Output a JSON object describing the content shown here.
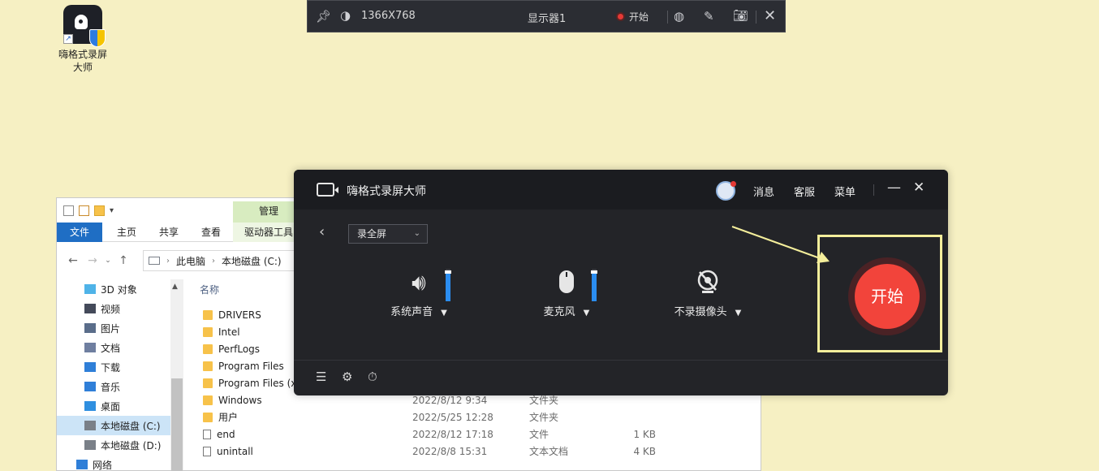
{
  "desktop": {
    "icon_label_line1": "嗨格式录屏",
    "icon_label_line2": "大师"
  },
  "topbar": {
    "resolution": "1366X768",
    "display": "显示器1",
    "record_label": "开始"
  },
  "explorer": {
    "ribbon_tabs": [
      "文件",
      "主页",
      "共享",
      "查看"
    ],
    "manage_tab": "管理",
    "drive_tools_tab": "驱动器工具",
    "breadcrumb": [
      "此电脑",
      "本地磁盘 (C:)"
    ],
    "tree_items": [
      {
        "label": "3D 对象",
        "icon": "3d-objects-icon",
        "color": "#4fb3e8"
      },
      {
        "label": "视频",
        "icon": "video-icon",
        "color": "#444a5a"
      },
      {
        "label": "图片",
        "icon": "pictures-icon",
        "color": "#5a6d8a"
      },
      {
        "label": "文档",
        "icon": "documents-icon",
        "color": "#6f7fa0"
      },
      {
        "label": "下载",
        "icon": "download-icon",
        "color": "#2f7fd8"
      },
      {
        "label": "音乐",
        "icon": "music-icon",
        "color": "#2f7fd8"
      },
      {
        "label": "桌面",
        "icon": "desktop-icon",
        "color": "#2f8fe0"
      },
      {
        "label": "本地磁盘 (C:)",
        "icon": "drive-icon",
        "color": "#7a8088"
      },
      {
        "label": "本地磁盘 (D:)",
        "icon": "drive-icon",
        "color": "#7a8088"
      },
      {
        "label": "网络",
        "icon": "network-icon",
        "color": "#2f7fd8"
      }
    ],
    "column_name": "名称",
    "files": [
      {
        "name": "DRIVERS",
        "date": "",
        "type": "",
        "size": "",
        "kind": "folder"
      },
      {
        "name": "Intel",
        "date": "",
        "type": "",
        "size": "",
        "kind": "folder"
      },
      {
        "name": "PerfLogs",
        "date": "",
        "type": "",
        "size": "",
        "kind": "folder"
      },
      {
        "name": "Program Files",
        "date": "",
        "type": "",
        "size": "",
        "kind": "folder"
      },
      {
        "name": "Program Files (x",
        "date": "",
        "type": "",
        "size": "",
        "kind": "folder"
      },
      {
        "name": "Windows",
        "date": "2022/8/12 9:34",
        "type": "文件夹",
        "size": "",
        "kind": "folder"
      },
      {
        "name": "用户",
        "date": "2022/5/25 12:28",
        "type": "文件夹",
        "size": "",
        "kind": "folder"
      },
      {
        "name": "end",
        "date": "2022/8/12 17:18",
        "type": "文件",
        "size": "1 KB",
        "kind": "doc"
      },
      {
        "name": "unintall",
        "date": "2022/8/8 15:31",
        "type": "文本文档",
        "size": "4 KB",
        "kind": "doc"
      }
    ]
  },
  "recorder": {
    "app_name": "嗨格式录屏大师",
    "nav": {
      "messages": "消息",
      "service": "客服",
      "menu": "菜单"
    },
    "mode": "录全屏",
    "sources": {
      "system_audio": "系统声音",
      "microphone": "麦克风",
      "camera": "不录摄像头"
    },
    "system_audio_level": 0.95,
    "mic_level": 0.95,
    "start_label": "开始"
  },
  "colors": {
    "desktop_bg": "#f6f0c3",
    "start_red": "#f2443b",
    "highlight": "#f4ee9b",
    "level_blue": "#2b8df0"
  }
}
